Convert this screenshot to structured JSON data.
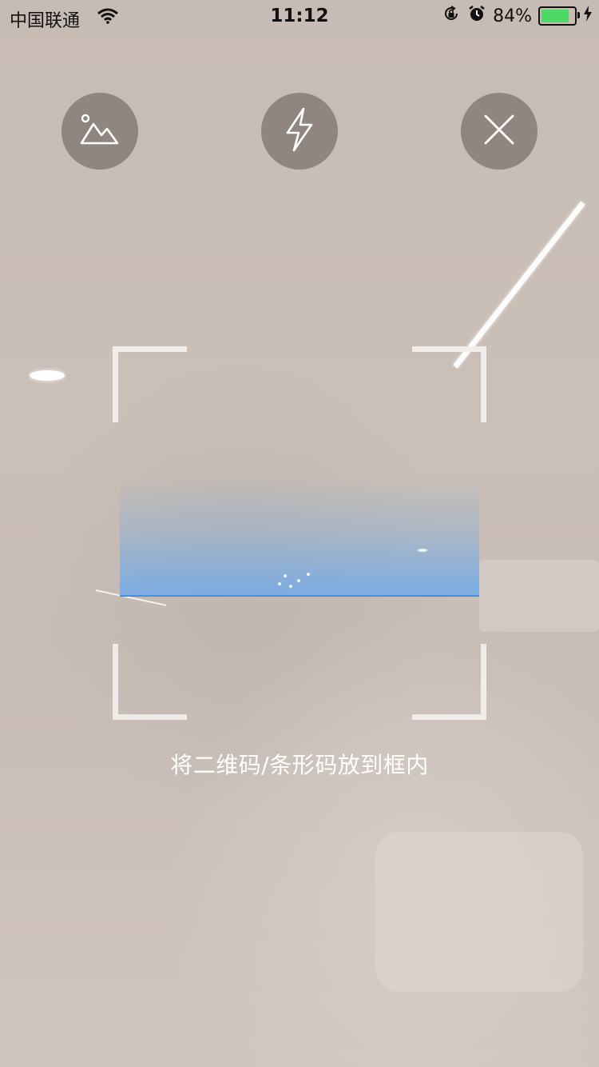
{
  "status_bar": {
    "carrier": "中国联通",
    "time": "11:12",
    "battery_percent": "84%",
    "battery_level": 0.84,
    "battery_color": "#4cd964",
    "icons": [
      "wifi-icon",
      "orientation-lock-icon",
      "alarm-icon",
      "battery-icon",
      "charging-bolt-icon"
    ]
  },
  "toolbar": {
    "buttons": [
      {
        "name": "album-button",
        "icon": "mountain-image-icon"
      },
      {
        "name": "flashlight-button",
        "icon": "lightning-bolt-icon"
      },
      {
        "name": "close-button",
        "icon": "close-x-icon"
      }
    ]
  },
  "scanner": {
    "hint": "将二维码/条形码放到框内",
    "scan_line_color": "#4a90d9"
  }
}
